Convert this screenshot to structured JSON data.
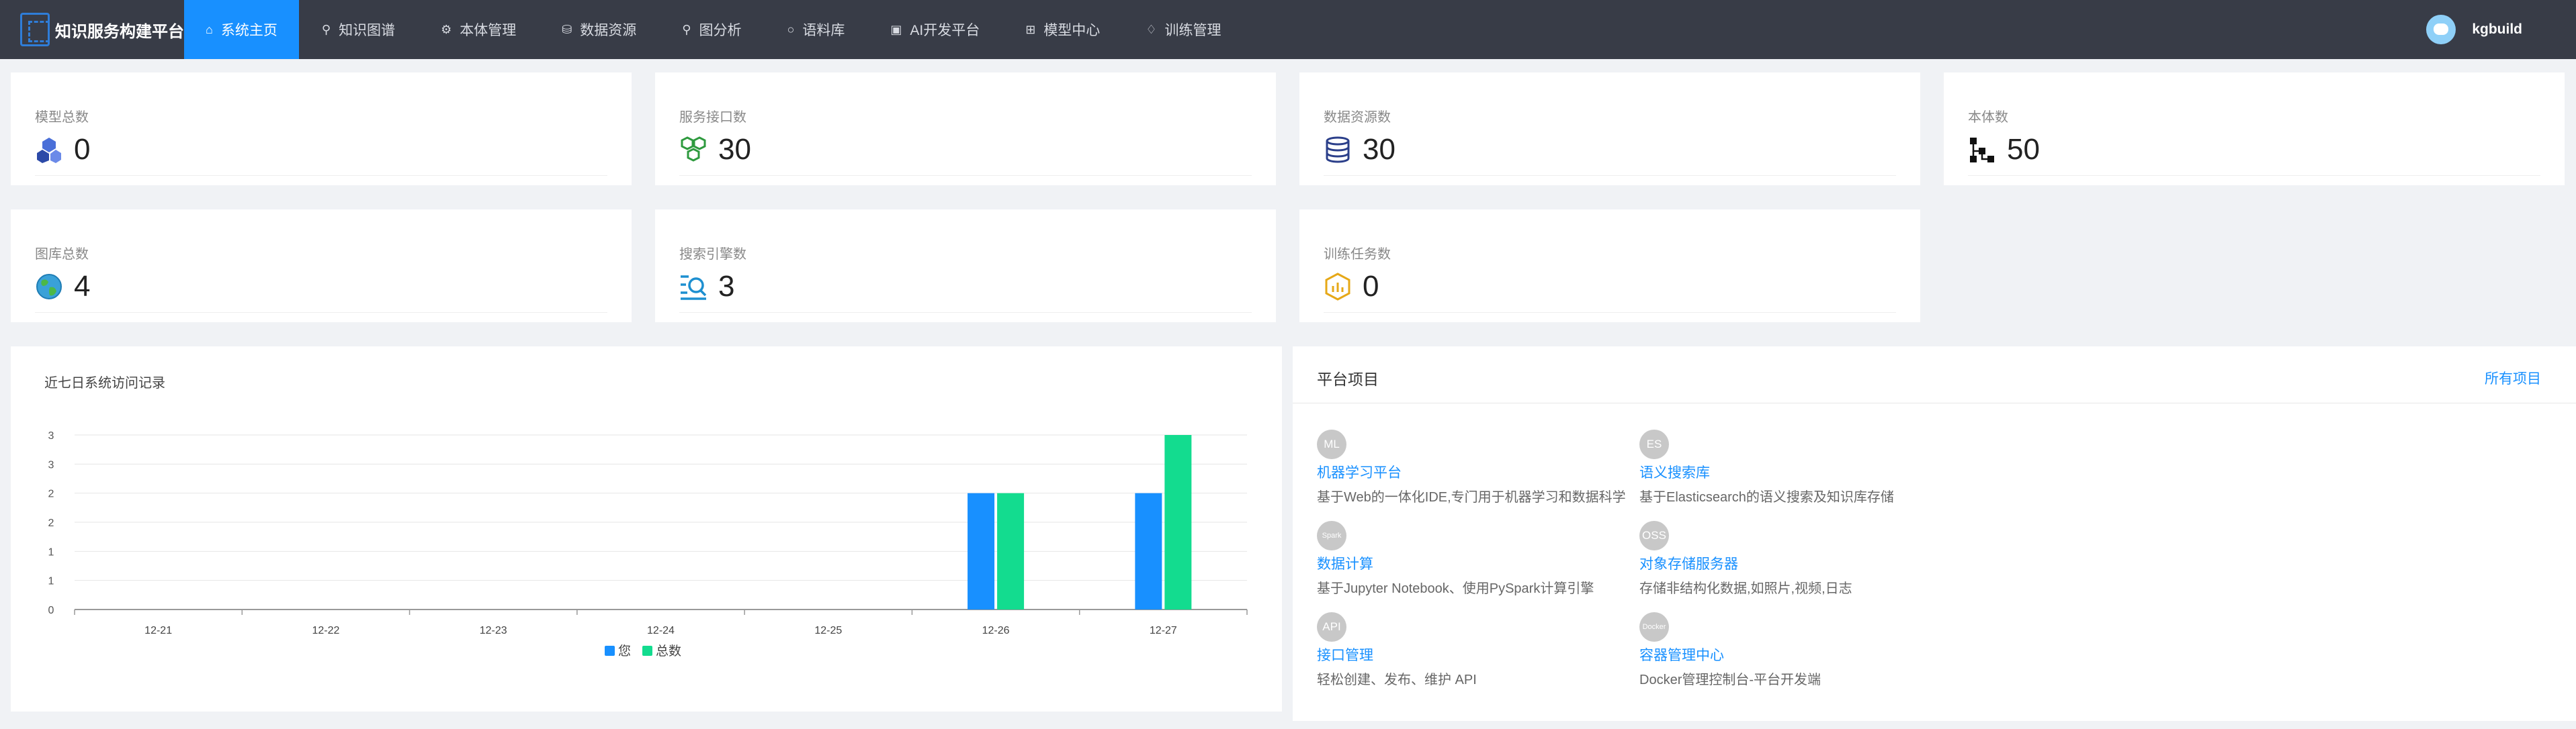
{
  "nav": {
    "app_title": "知识服务构建平台",
    "items": [
      {
        "label": "系统主页",
        "icon": "home-icon"
      },
      {
        "label": "知识图谱",
        "icon": "graph-icon"
      },
      {
        "label": "本体管理",
        "icon": "ontology-icon"
      },
      {
        "label": "数据资源",
        "icon": "data-icon"
      },
      {
        "label": "图分析",
        "icon": "analysis-icon"
      },
      {
        "label": "语料库",
        "icon": "chat-icon"
      },
      {
        "label": "AI开发平台",
        "icon": "chart-icon"
      },
      {
        "label": "模型中心",
        "icon": "grid-icon"
      },
      {
        "label": "训练管理",
        "icon": "bell-icon"
      }
    ],
    "username": "kgbuild"
  },
  "stats": [
    {
      "title": "模型总数",
      "value": "0",
      "icon": "cubes-icon",
      "color": "#3b5fc4"
    },
    {
      "title": "服务接口数",
      "value": "30",
      "icon": "hexagon-network-icon",
      "color": "#2e9a3e"
    },
    {
      "title": "数据资源数",
      "value": "30",
      "icon": "database-icon",
      "color": "#2b3f8a"
    },
    {
      "title": "本体数",
      "value": "50",
      "icon": "hierarchy-icon",
      "color": "#111111"
    },
    {
      "title": "图库总数",
      "value": "4",
      "icon": "globe-icon",
      "color": "#3aa1d8"
    },
    {
      "title": "搜索引擎数",
      "value": "3",
      "icon": "search-list-icon",
      "color": "#1d8fd0"
    },
    {
      "title": "训练任务数",
      "value": "0",
      "icon": "hexagon-chart-icon",
      "color": "#e6a817"
    }
  ],
  "chart_panel": {
    "title": "近七日系统访问记录"
  },
  "chart_data": {
    "type": "bar",
    "categories": [
      "12-21",
      "12-22",
      "12-23",
      "12-24",
      "12-25",
      "12-26",
      "12-27"
    ],
    "series": [
      {
        "name": "您",
        "values": [
          0,
          0,
          0,
          0,
          0,
          2,
          2
        ],
        "color": "#1890ff"
      },
      {
        "name": "总数",
        "values": [
          0,
          0,
          0,
          0,
          0,
          2,
          3
        ],
        "color": "#13dc8f"
      }
    ],
    "ytick_labels": [
      "0",
      "1",
      "1",
      "2",
      "2",
      "3",
      "3"
    ],
    "ylim": [
      0,
      3
    ],
    "grid": true,
    "legend_position": "bottom-center"
  },
  "projects_panel": {
    "title": "平台项目",
    "all_link": "所有项目",
    "items": [
      {
        "badge": "ML",
        "name": "机器学习平台",
        "desc": "基于Web的一体化IDE,专门用于机器学习和数据科学"
      },
      {
        "badge": "ES",
        "name": "语义搜索库",
        "desc": "基于Elasticsearch的语义搜索及知识库存储"
      },
      {
        "badge": "Spark",
        "name": "数据计算",
        "desc": "基于Jupyter Notebook、使用PySpark计算引擎"
      },
      {
        "badge": "OSS",
        "name": "对象存储服务器",
        "desc": "存储非结构化数据,如照片,视频,日志"
      },
      {
        "badge": "API",
        "name": "接口管理",
        "desc": "轻松创建、发布、维护 API"
      },
      {
        "badge": "Docker",
        "name": "容器管理中心",
        "desc": "Docker管理控制台-平台开发端"
      }
    ]
  }
}
